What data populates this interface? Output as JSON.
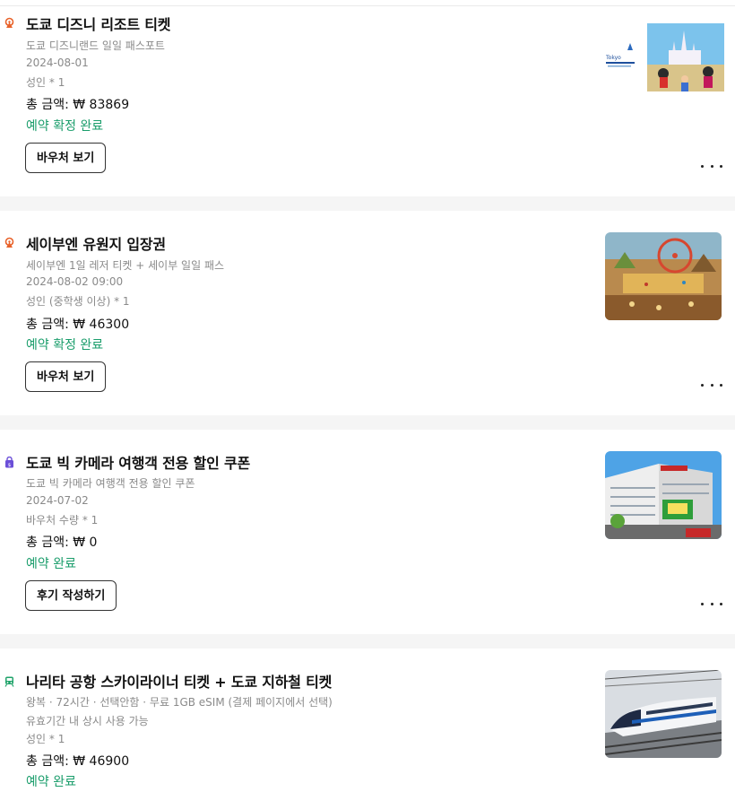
{
  "orders": [
    {
      "title": "도쿄 디즈니 리조트 티켓",
      "category_icon": "amusement-park-icon",
      "lines": [
        "도쿄 디즈니랜드 일일 패스포트",
        "2024-08-01",
        "성인 * 1"
      ],
      "price_label": "총 금액:",
      "price_value": "₩ 83869",
      "status": "예약 확정 완료",
      "button": "바우처 보기",
      "image": "tokyo-disneyland-castle-thumbnail"
    },
    {
      "title": "세이부엔 유원지 입장권",
      "category_icon": "amusement-park-icon",
      "lines": [
        "세이부엔 1일 레저 티켓 + 세이부 일일 패스",
        "2024-08-02 09:00",
        "성인 (중학생 이상) * 1"
      ],
      "price_label": "총 금액:",
      "price_value": "₩ 46300",
      "status": "예약 확정 완료",
      "button": "바우처 보기",
      "image": "seibuen-amusement-park-illustration-thumbnail"
    },
    {
      "title": "도쿄 빅 카메라 여행객 전용 할인 쿠폰",
      "category_icon": "shopping-bag-icon",
      "lines": [
        "도쿄 빅 카메라 여행객 전용 할인 쿠폰",
        "2024-07-02",
        "바우처 수량 * 1"
      ],
      "price_label": "총 금액:",
      "price_value": "₩ 0",
      "status": "예약 완료",
      "button": "후기 작성하기",
      "image": "bic-camera-building-thumbnail"
    },
    {
      "title": "나리타 공항 스카이라이너 티켓 + 도쿄 지하철 티켓",
      "category_icon": "train-icon",
      "lines": [
        "왕복 · 72시간 · 선택안함 · 무료 1GB eSIM (결제 페이지에서 선택)",
        "유효기간 내 상시 사용 가능",
        "성인 * 1"
      ],
      "price_label": "총 금액:",
      "price_value": "₩ 46900",
      "status": "예약 완료",
      "button": "",
      "image": "skyliner-train-thumbnail"
    }
  ],
  "colors": {
    "status_green": "#1a9d6b",
    "icon_orange": "#e8622a",
    "icon_purple": "#6b4fd8",
    "icon_green": "#1fa36a",
    "separator": "#f5f5f5"
  }
}
